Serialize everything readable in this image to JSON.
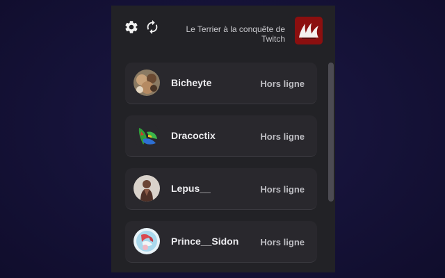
{
  "header": {
    "title": "Le Terrier à la conquête de Twitch",
    "settings_icon": "gear-icon",
    "refresh_icon": "refresh-icon",
    "logo_icon": "red-claw-logo"
  },
  "streamers": [
    {
      "name": "Bicheyte",
      "status": "Hors ligne"
    },
    {
      "name": "Dracoctix",
      "status": "Hors ligne"
    },
    {
      "name": "Lepus__",
      "status": "Hors ligne"
    },
    {
      "name": "Prince__Sidon",
      "status": "Hors ligne"
    }
  ],
  "colors": {
    "background": "#16133a",
    "panel": "#222226",
    "card": "#29282d",
    "text": "#ececef",
    "logo": "#8b0f0f"
  }
}
